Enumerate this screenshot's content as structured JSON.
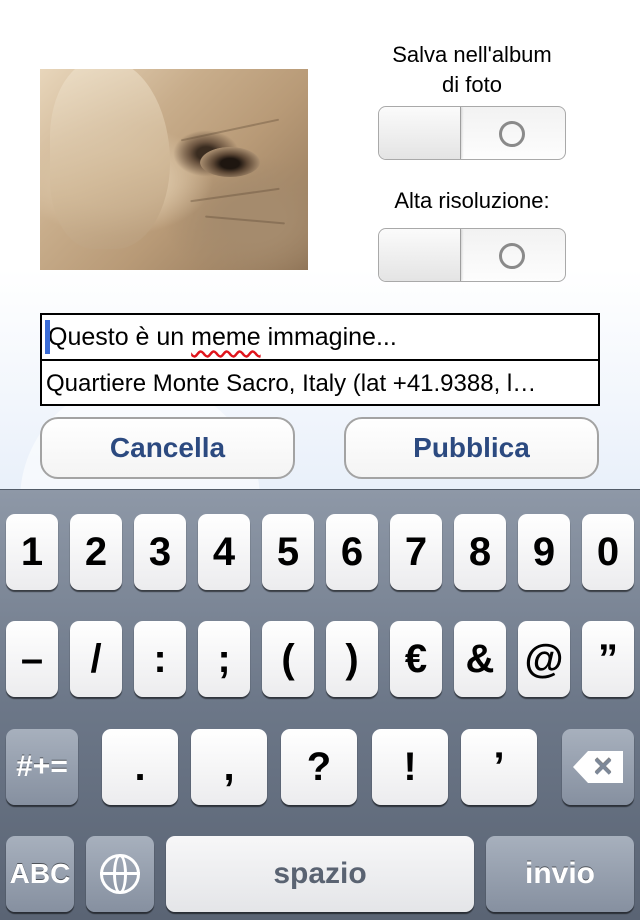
{
  "options": {
    "save_album_label": "Salva nell'album di foto",
    "save_album_line1": "Salva nell'album",
    "save_album_line2": "di foto",
    "high_res_label": "Alta risoluzione:"
  },
  "caption": {
    "text_before": "Questo è un ",
    "misspelled": "meme",
    "text_after": " immagine...",
    "location": "Quartiere Monte Sacro, Italy (lat +41.9388, l…"
  },
  "buttons": {
    "cancel": "Cancella",
    "publish": "Pubblica"
  },
  "keyboard": {
    "row1": [
      "1",
      "2",
      "3",
      "4",
      "5",
      "6",
      "7",
      "8",
      "9",
      "0"
    ],
    "row2": [
      "–",
      "/",
      ":",
      ";",
      "(",
      ")",
      "€",
      "&",
      "@",
      "”"
    ],
    "row3": [
      ".",
      ",",
      "?",
      "!",
      "’"
    ],
    "symbols_key": "#+=",
    "abc_key": "ABC",
    "space_key": "spazio",
    "return_key": "invio"
  },
  "colors": {
    "button_text": "#2c4a80",
    "cursor": "#3a6cd6",
    "keyboard_bg": "#6c7788"
  }
}
